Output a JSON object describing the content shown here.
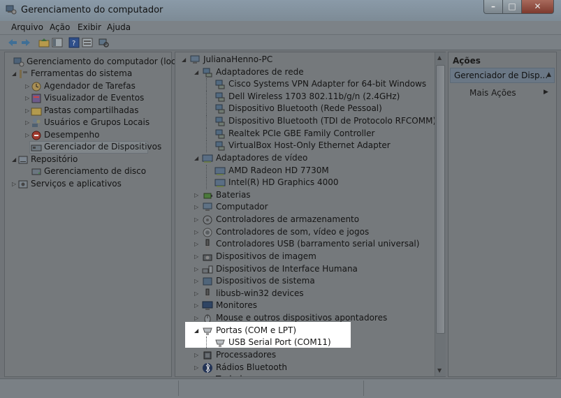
{
  "window": {
    "title": "Gerenciamento do computador"
  },
  "menu": [
    "Arquivo",
    "Ação",
    "Exibir",
    "Ajuda"
  ],
  "left_tree": [
    {
      "label": "Gerenciamento do computador (local)",
      "level": 0,
      "expander": "",
      "icon": "computer-management-icon"
    },
    {
      "label": "Ferramentas do sistema",
      "level": 1,
      "expander": "◢",
      "icon": "tools-icon"
    },
    {
      "label": "Agendador de Tarefas",
      "level": 2,
      "expander": "▷",
      "icon": "clock-icon"
    },
    {
      "label": "Visualizador de Eventos",
      "level": 2,
      "expander": "▷",
      "icon": "event-viewer-icon"
    },
    {
      "label": "Pastas compartilhadas",
      "level": 2,
      "expander": "▷",
      "icon": "shared-folder-icon"
    },
    {
      "label": "Usuários e Grupos Locais",
      "level": 2,
      "expander": "▷",
      "icon": "users-icon"
    },
    {
      "label": "Desempenho",
      "level": 2,
      "expander": "▷",
      "icon": "performance-icon"
    },
    {
      "label": "Gerenciador de Dispositivos",
      "level": 2,
      "expander": "",
      "icon": "device-manager-icon",
      "selected": true
    },
    {
      "label": "Repositório",
      "level": 1,
      "expander": "◢",
      "icon": "storage-icon"
    },
    {
      "label": "Gerenciamento de disco",
      "level": 2,
      "expander": "",
      "icon": "disk-icon"
    },
    {
      "label": "Serviços e aplicativos",
      "level": 1,
      "expander": "▷",
      "icon": "services-icon"
    }
  ],
  "device_tree": [
    {
      "label": "JulianaHenno-PC",
      "level": 0,
      "expander": "◢",
      "icon": "computer-icon"
    },
    {
      "label": "Adaptadores de rede",
      "level": 1,
      "expander": "◢",
      "icon": "network-adapter-icon"
    },
    {
      "label": "Cisco Systems VPN Adapter for 64-bit Windows",
      "level": 2,
      "expander": "",
      "icon": "network-adapter-icon"
    },
    {
      "label": "Dell Wireless 1703 802.11b/g/n (2.4GHz)",
      "level": 2,
      "expander": "",
      "icon": "network-adapter-icon"
    },
    {
      "label": "Dispositivo Bluetooth (Rede Pessoal)",
      "level": 2,
      "expander": "",
      "icon": "network-adapter-icon"
    },
    {
      "label": "Dispositivo Bluetooth (TDI de Protocolo RFCOMM)",
      "level": 2,
      "expander": "",
      "icon": "network-adapter-icon"
    },
    {
      "label": "Realtek PCIe GBE Family Controller",
      "level": 2,
      "expander": "",
      "icon": "network-adapter-icon"
    },
    {
      "label": "VirtualBox Host-Only Ethernet Adapter",
      "level": 2,
      "expander": "",
      "icon": "network-adapter-icon"
    },
    {
      "label": "Adaptadores de vídeo",
      "level": 1,
      "expander": "◢",
      "icon": "display-adapter-icon"
    },
    {
      "label": "AMD Radeon HD 7730M",
      "level": 2,
      "expander": "",
      "icon": "display-adapter-icon"
    },
    {
      "label": "Intel(R) HD Graphics 4000",
      "level": 2,
      "expander": "",
      "icon": "display-adapter-icon"
    },
    {
      "label": "Baterias",
      "level": 1,
      "expander": "▷",
      "icon": "battery-icon"
    },
    {
      "label": "Computador",
      "level": 1,
      "expander": "▷",
      "icon": "computer-icon"
    },
    {
      "label": "Controladores de armazenamento",
      "level": 1,
      "expander": "▷",
      "icon": "storage-controller-icon"
    },
    {
      "label": "Controladores de som, vídeo e jogos",
      "level": 1,
      "expander": "▷",
      "icon": "sound-icon"
    },
    {
      "label": "Controladores USB (barramento serial universal)",
      "level": 1,
      "expander": "▷",
      "icon": "usb-icon"
    },
    {
      "label": "Dispositivos de imagem",
      "level": 1,
      "expander": "▷",
      "icon": "imaging-device-icon"
    },
    {
      "label": "Dispositivos de Interface Humana",
      "level": 1,
      "expander": "▷",
      "icon": "hid-icon"
    },
    {
      "label": "Dispositivos de sistema",
      "level": 1,
      "expander": "▷",
      "icon": "system-device-icon"
    },
    {
      "label": "libusb-win32 devices",
      "level": 1,
      "expander": "▷",
      "icon": "usb-icon"
    },
    {
      "label": "Monitores",
      "level": 1,
      "expander": "▷",
      "icon": "monitor-icon"
    },
    {
      "label": "Mouse e outros dispositivos apontadores",
      "level": 1,
      "expander": "▷",
      "icon": "mouse-icon"
    },
    {
      "label": "Portas (COM e LPT)",
      "level": 1,
      "expander": "◢",
      "icon": "port-icon"
    },
    {
      "label": "USB Serial Port (COM11)",
      "level": 2,
      "expander": "",
      "icon": "port-icon"
    },
    {
      "label": "Processadores",
      "level": 1,
      "expander": "▷",
      "icon": "processor-icon"
    },
    {
      "label": "Rádios Bluetooth",
      "level": 1,
      "expander": "▷",
      "icon": "bluetooth-icon"
    },
    {
      "label": "Teclados",
      "level": 1,
      "expander": "▷",
      "icon": "keyboard-icon"
    }
  ],
  "actions": {
    "title": "Ações",
    "section": "Gerenciador de Disp...",
    "more": "Mais Ações"
  },
  "colors": {
    "highlight": "#ffffff",
    "dim_overlay": "#707478"
  }
}
